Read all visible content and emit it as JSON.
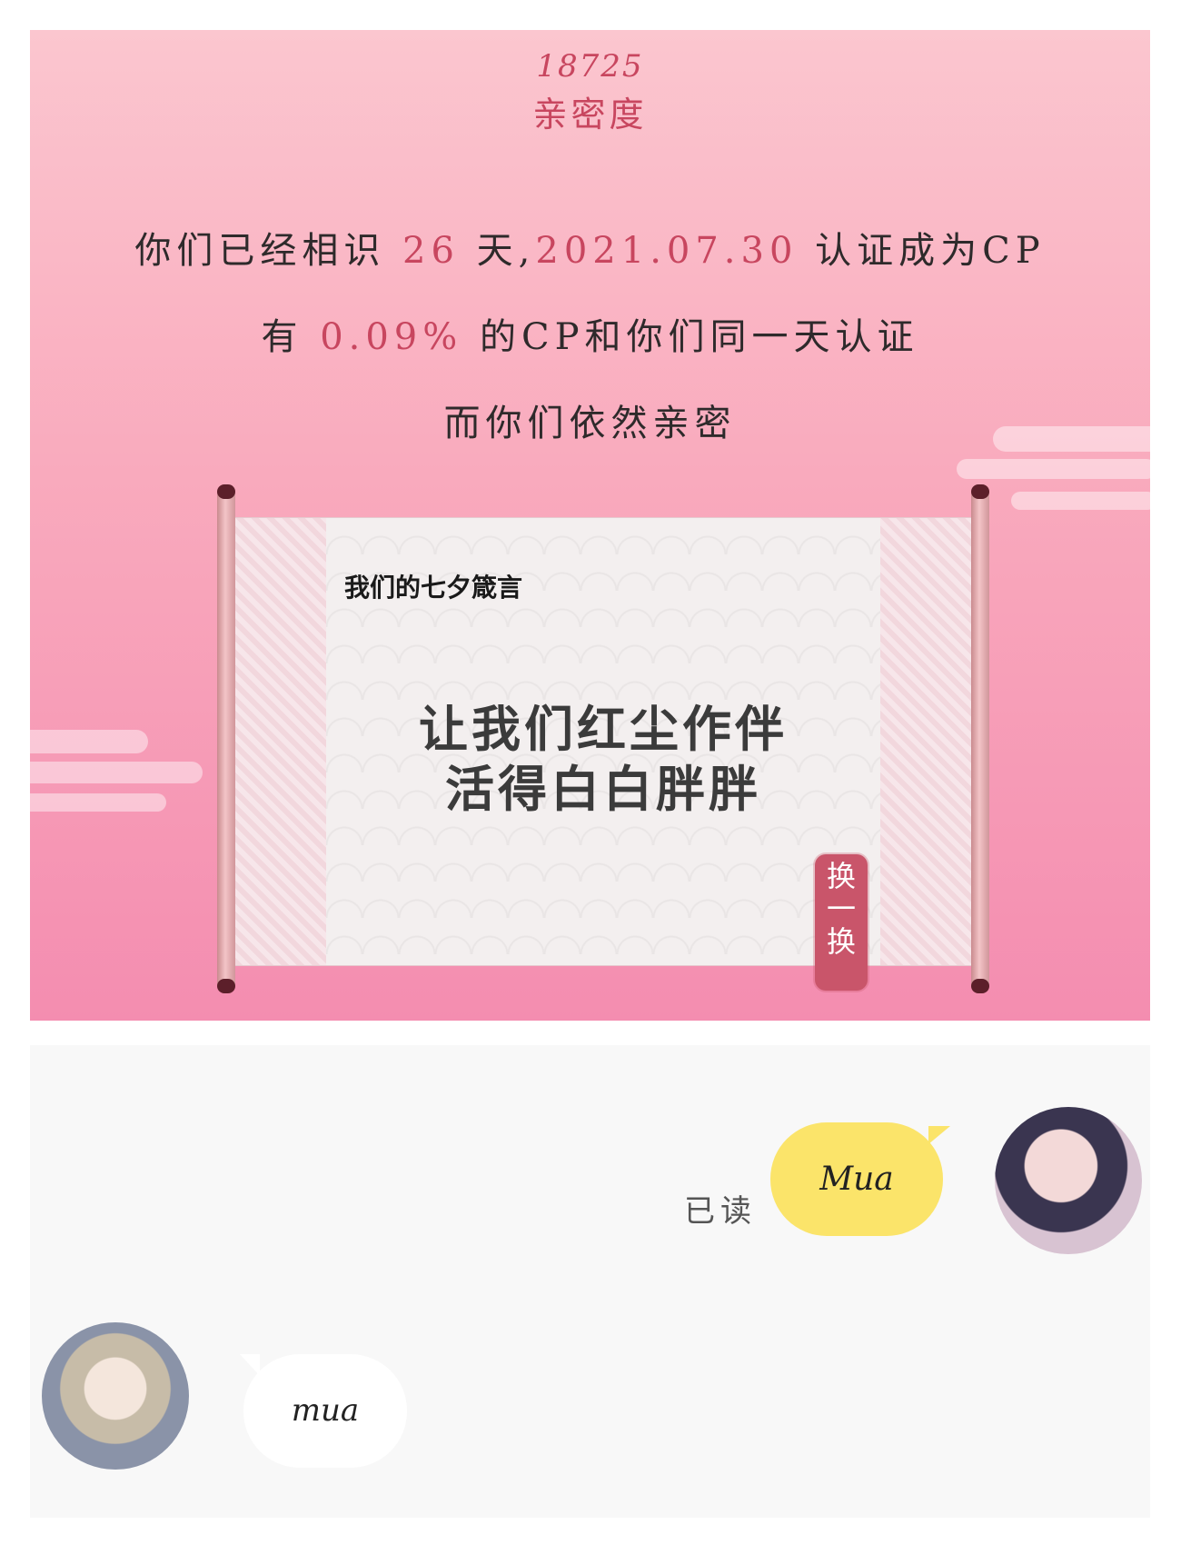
{
  "header": {
    "intimacy_value": "18725",
    "intimacy_label": "亲密度"
  },
  "info": {
    "line1_a": "你们已经相识",
    "days": "26",
    "line1_b": "天,",
    "date": "2021.07.30",
    "line1_c": "认证成为CP",
    "line2_a": "有",
    "percent": "0.09%",
    "line2_b": "的CP和你们同一天认证",
    "line3": "而你们依然亲密"
  },
  "scroll": {
    "title": "我们的七夕箴言",
    "motto_line1": "让我们红尘作伴",
    "motto_line2": "活得白白胖胖",
    "change_button": [
      "换",
      "一",
      "换"
    ]
  },
  "chat": {
    "read_status": "已读",
    "my_message": "Mua",
    "their_message": "mua"
  },
  "colors": {
    "accent": "#c8465f",
    "bubble_mine": "#fbe46a",
    "bubble_theirs": "#ffffff"
  }
}
